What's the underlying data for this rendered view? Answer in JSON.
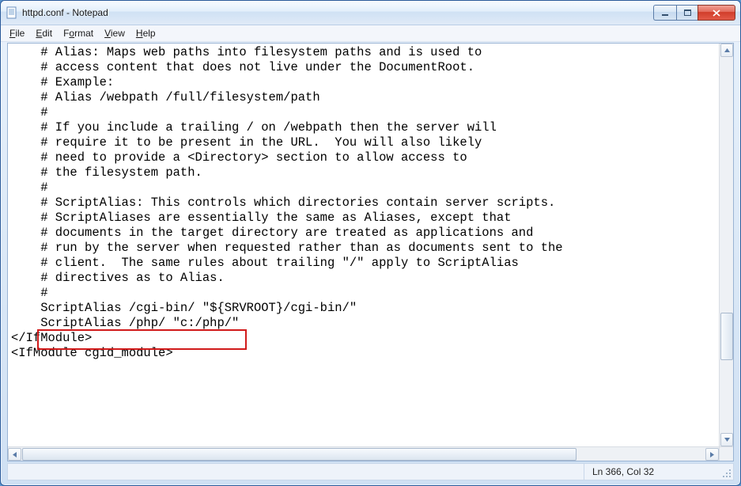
{
  "window": {
    "title": "httpd.conf - Notepad"
  },
  "menubar": {
    "file": "File",
    "edit": "Edit",
    "format": "Format",
    "view": "View",
    "help": "Help"
  },
  "editor": {
    "lines": [
      "    # Alias: Maps web paths into filesystem paths and is used to",
      "    # access content that does not live under the DocumentRoot.",
      "    # Example:",
      "    # Alias /webpath /full/filesystem/path",
      "    #",
      "    # If you include a trailing / on /webpath then the server will",
      "    # require it to be present in the URL.  You will also likely",
      "    # need to provide a <Directory> section to allow access to",
      "    # the filesystem path.",
      "",
      "    #",
      "    # ScriptAlias: This controls which directories contain server scripts.",
      "    # ScriptAliases are essentially the same as Aliases, except that",
      "    # documents in the target directory are treated as applications and",
      "    # run by the server when requested rather than as documents sent to the",
      "    # client.  The same rules about trailing \"/\" apply to ScriptAlias",
      "    # directives as to Alias.",
      "    #",
      "    ScriptAlias /cgi-bin/ \"${SRVROOT}/cgi-bin/\"",
      "    ScriptAlias /php/ \"c:/php/\"",
      "",
      "</IfModule>",
      "",
      "<IfModule cgid_module>"
    ],
    "highlighted_line_index": 19
  },
  "statusbar": {
    "position": "Ln 366, Col 32"
  }
}
